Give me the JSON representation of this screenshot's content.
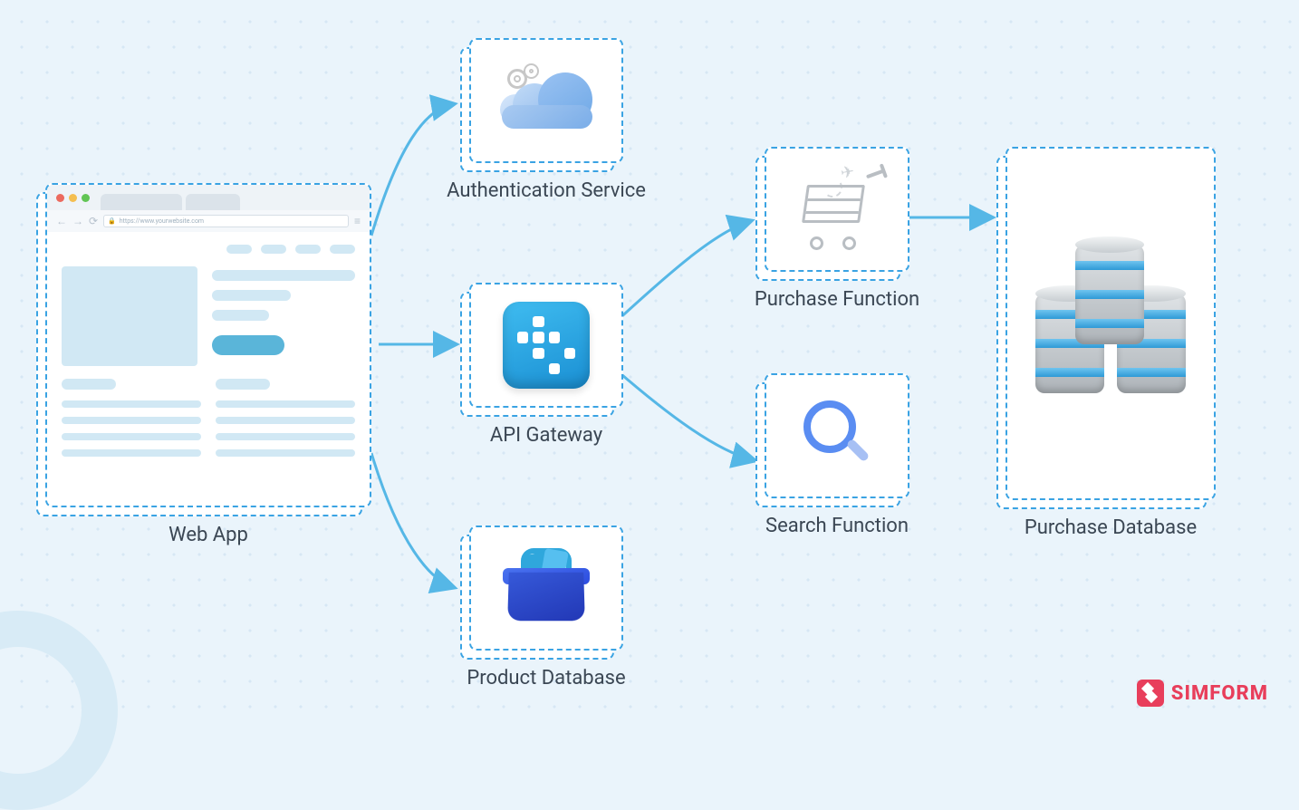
{
  "brand": {
    "name": "SIMFORM"
  },
  "nodes": {
    "web_app": {
      "label": "Web App",
      "icon": "browser-window-icon"
    },
    "auth_service": {
      "label": "Authentication Service",
      "icon": "cloud-gears-icon"
    },
    "api_gateway": {
      "label": "API Gateway",
      "icon": "pixel-tile-icon"
    },
    "product_db": {
      "label": "Product Database",
      "icon": "shopping-basket-icon"
    },
    "purchase_fn": {
      "label": "Purchase Function",
      "icon": "shopping-cart-icon"
    },
    "search_fn": {
      "label": "Search Function",
      "icon": "magnifier-icon"
    },
    "purchase_db": {
      "label": "Purchase Database",
      "icon": "database-cylinders-icon"
    }
  },
  "edges": [
    {
      "from": "web_app",
      "to": "auth_service"
    },
    {
      "from": "web_app",
      "to": "api_gateway"
    },
    {
      "from": "web_app",
      "to": "product_db"
    },
    {
      "from": "api_gateway",
      "to": "purchase_fn"
    },
    {
      "from": "api_gateway",
      "to": "search_fn"
    },
    {
      "from": "purchase_fn",
      "to": "purchase_db"
    }
  ],
  "webapp_mock": {
    "url_text": "https://www.yourwebsite.com",
    "traffic_light_colors": [
      "#ec6a5e",
      "#f4be4f",
      "#61c554"
    ]
  },
  "colors": {
    "dash_border": "#3aa3e3",
    "arrow": "#55b7e6",
    "label": "#3b4754",
    "brand": "#e83e5b"
  }
}
